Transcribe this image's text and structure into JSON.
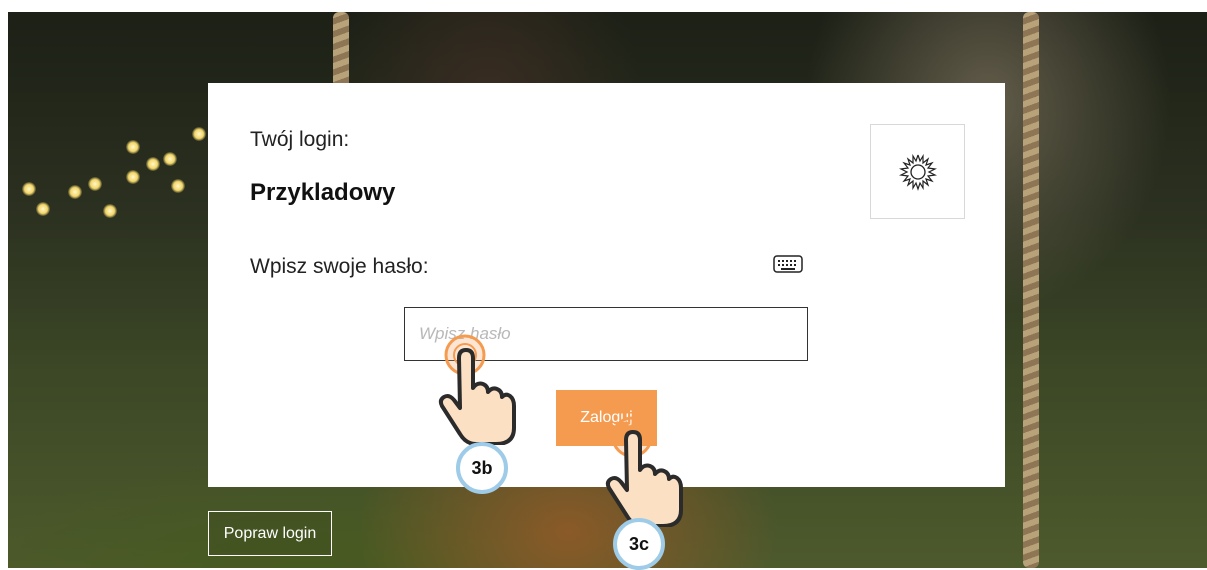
{
  "login": {
    "label": "Twój login:",
    "value": "Przykladowy"
  },
  "password": {
    "label": "Wpisz swoje hasło:",
    "placeholder": "Wpisz hasło",
    "value": ""
  },
  "actions": {
    "login_button": "Zaloguj",
    "fix_login_button": "Popraw login"
  },
  "annotations": {
    "step_password": "3b",
    "step_login": "3c"
  },
  "icons": {
    "theme_toggle": "sun-icon",
    "virtual_keyboard": "keyboard-icon",
    "pointer": "hand-pointer-icon"
  },
  "colors": {
    "accent": "#f59b4f",
    "badge_border": "#9ecbe8"
  }
}
